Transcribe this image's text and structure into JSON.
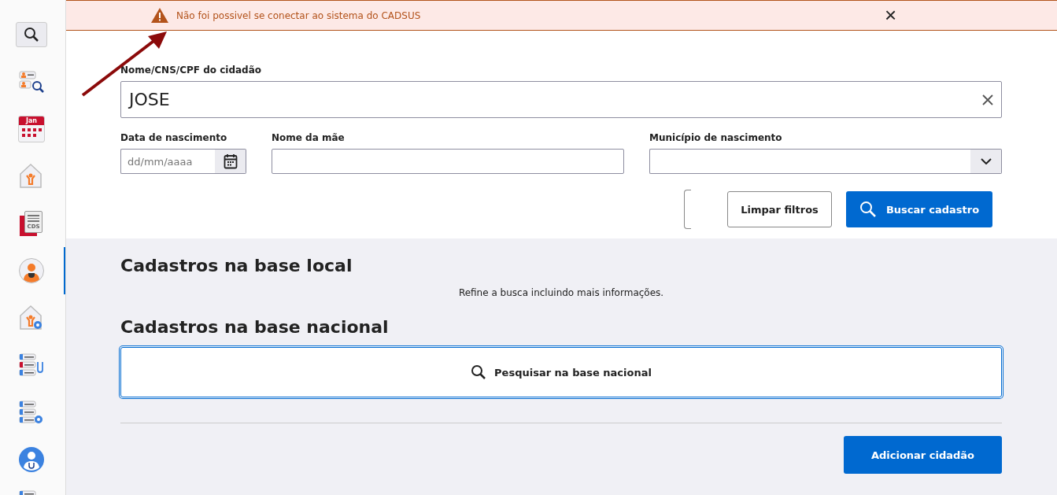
{
  "sidebar": {
    "items": [
      {
        "kind": "search",
        "selected": false
      },
      {
        "kind": "people-search",
        "selected": false
      },
      {
        "kind": "calendar",
        "label": "Jan",
        "selected": false
      },
      {
        "kind": "house-person",
        "selected": false
      },
      {
        "kind": "document",
        "label": "CDS",
        "selected": false
      },
      {
        "kind": "person",
        "selected": true
      },
      {
        "kind": "house-gear",
        "selected": false
      },
      {
        "kind": "list-stethoscope",
        "selected": false
      },
      {
        "kind": "list-gear",
        "selected": false
      },
      {
        "kind": "doctor",
        "selected": false
      },
      {
        "kind": "list",
        "selected": false
      }
    ]
  },
  "alert": {
    "message": "Não foi possivel se conectar ao sistema do CADSUS",
    "close": "×"
  },
  "form": {
    "name_label": "Nome/CNS/CPF do cidadão",
    "name_value": "JOSE",
    "birth_label": "Data de nascimento",
    "birth_placeholder": "dd/mm/aaaa",
    "mother_label": "Nome da mãe",
    "city_label": "Município de nascimento",
    "clear_button": "Limpar filtros",
    "search_button": "Buscar cadastro"
  },
  "local": {
    "title": "Cadastros na base local",
    "message": "Refine a busca incluindo mais informações."
  },
  "national": {
    "title": "Cadastros na base nacional",
    "search_button": "Pesquisar na base nacional"
  },
  "add_button": "Adicionar cidadão"
}
